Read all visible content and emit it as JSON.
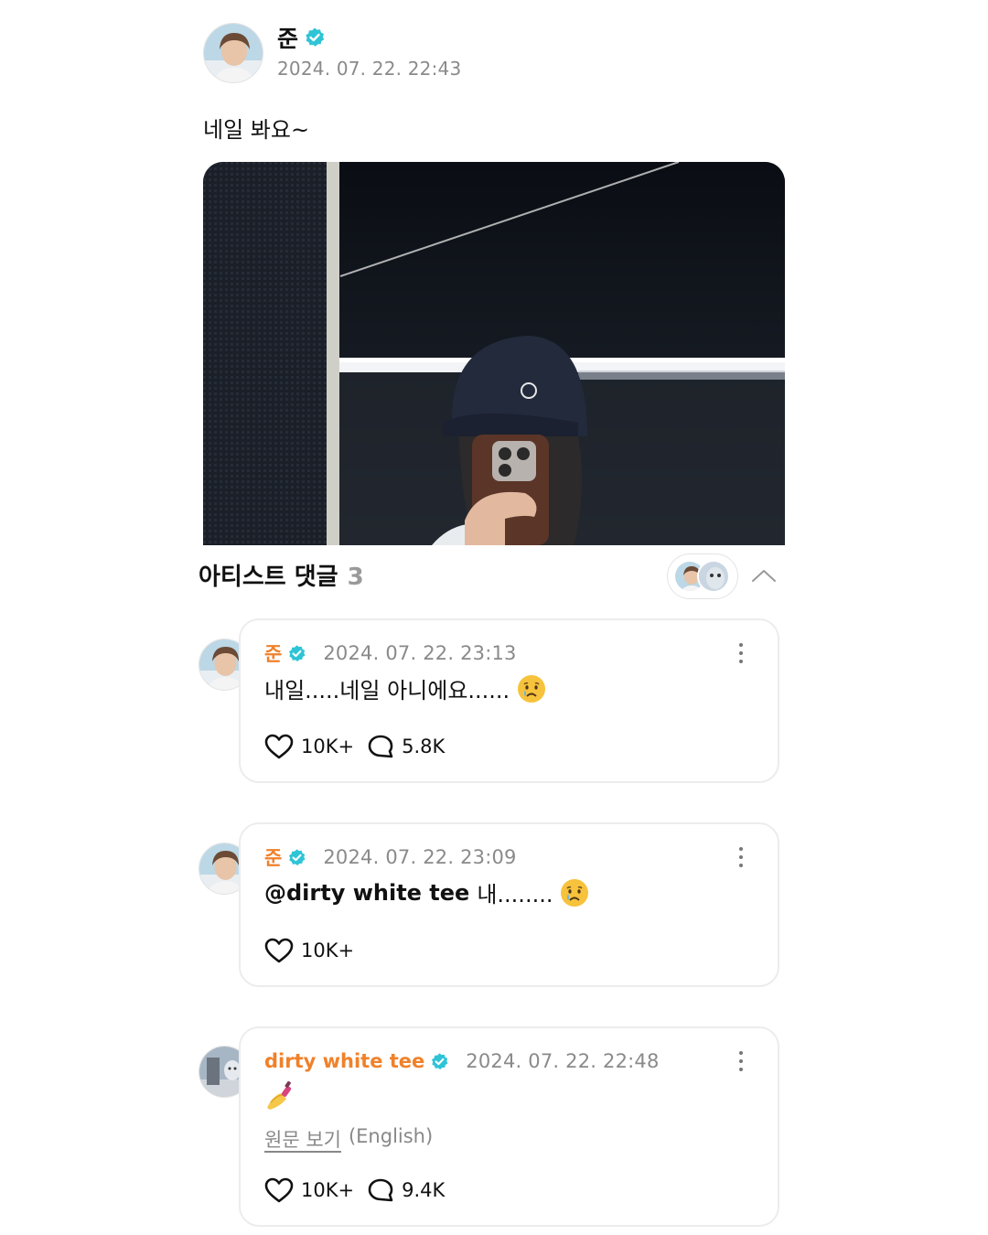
{
  "post": {
    "author": "준",
    "timestamp": "2024. 07. 22. 22:43",
    "text": "네일 봐요~"
  },
  "artist_comments": {
    "title": "아티스트 댓글",
    "count": "3"
  },
  "comments": [
    {
      "author": "준",
      "timestamp": "2024. 07. 22. 23:13",
      "text": "내일.....네일 아니에요......",
      "emoji": "crying-face",
      "likes": "10K+",
      "replies": "5.8K"
    },
    {
      "author": "준",
      "timestamp": "2024. 07. 22. 23:09",
      "mention": "@dirty white tee",
      "text": "내........",
      "emoji": "crying-face",
      "likes": "10K+"
    },
    {
      "author": "dirty white tee",
      "timestamp": "2024. 07. 22. 22:48",
      "emoji": "nail-polish",
      "view_original": "원문 보기",
      "original_language": "(English)",
      "likes": "10K+",
      "replies": "9.4K"
    }
  ],
  "colors": {
    "author_accent": "#f0812a",
    "verified": "#2ec4d6",
    "timestamp": "#8a8a8a"
  }
}
